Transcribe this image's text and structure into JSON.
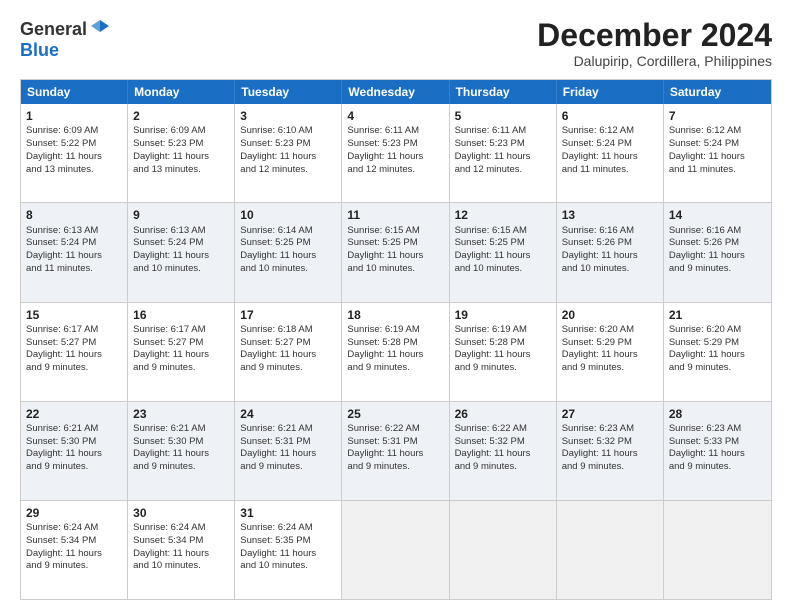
{
  "logo": {
    "general": "General",
    "blue": "Blue"
  },
  "title": {
    "month": "December 2024",
    "location": "Dalupirip, Cordillera, Philippines"
  },
  "header_days": [
    "Sunday",
    "Monday",
    "Tuesday",
    "Wednesday",
    "Thursday",
    "Friday",
    "Saturday"
  ],
  "weeks": [
    [
      {
        "day": "1",
        "lines": [
          "Sunrise: 6:09 AM",
          "Sunset: 5:22 PM",
          "Daylight: 11 hours",
          "and 13 minutes."
        ]
      },
      {
        "day": "2",
        "lines": [
          "Sunrise: 6:09 AM",
          "Sunset: 5:23 PM",
          "Daylight: 11 hours",
          "and 13 minutes."
        ]
      },
      {
        "day": "3",
        "lines": [
          "Sunrise: 6:10 AM",
          "Sunset: 5:23 PM",
          "Daylight: 11 hours",
          "and 12 minutes."
        ]
      },
      {
        "day": "4",
        "lines": [
          "Sunrise: 6:11 AM",
          "Sunset: 5:23 PM",
          "Daylight: 11 hours",
          "and 12 minutes."
        ]
      },
      {
        "day": "5",
        "lines": [
          "Sunrise: 6:11 AM",
          "Sunset: 5:23 PM",
          "Daylight: 11 hours",
          "and 12 minutes."
        ]
      },
      {
        "day": "6",
        "lines": [
          "Sunrise: 6:12 AM",
          "Sunset: 5:24 PM",
          "Daylight: 11 hours",
          "and 11 minutes."
        ]
      },
      {
        "day": "7",
        "lines": [
          "Sunrise: 6:12 AM",
          "Sunset: 5:24 PM",
          "Daylight: 11 hours",
          "and 11 minutes."
        ]
      }
    ],
    [
      {
        "day": "8",
        "lines": [
          "Sunrise: 6:13 AM",
          "Sunset: 5:24 PM",
          "Daylight: 11 hours",
          "and 11 minutes."
        ]
      },
      {
        "day": "9",
        "lines": [
          "Sunrise: 6:13 AM",
          "Sunset: 5:24 PM",
          "Daylight: 11 hours",
          "and 10 minutes."
        ]
      },
      {
        "day": "10",
        "lines": [
          "Sunrise: 6:14 AM",
          "Sunset: 5:25 PM",
          "Daylight: 11 hours",
          "and 10 minutes."
        ]
      },
      {
        "day": "11",
        "lines": [
          "Sunrise: 6:15 AM",
          "Sunset: 5:25 PM",
          "Daylight: 11 hours",
          "and 10 minutes."
        ]
      },
      {
        "day": "12",
        "lines": [
          "Sunrise: 6:15 AM",
          "Sunset: 5:25 PM",
          "Daylight: 11 hours",
          "and 10 minutes."
        ]
      },
      {
        "day": "13",
        "lines": [
          "Sunrise: 6:16 AM",
          "Sunset: 5:26 PM",
          "Daylight: 11 hours",
          "and 10 minutes."
        ]
      },
      {
        "day": "14",
        "lines": [
          "Sunrise: 6:16 AM",
          "Sunset: 5:26 PM",
          "Daylight: 11 hours",
          "and 9 minutes."
        ]
      }
    ],
    [
      {
        "day": "15",
        "lines": [
          "Sunrise: 6:17 AM",
          "Sunset: 5:27 PM",
          "Daylight: 11 hours",
          "and 9 minutes."
        ]
      },
      {
        "day": "16",
        "lines": [
          "Sunrise: 6:17 AM",
          "Sunset: 5:27 PM",
          "Daylight: 11 hours",
          "and 9 minutes."
        ]
      },
      {
        "day": "17",
        "lines": [
          "Sunrise: 6:18 AM",
          "Sunset: 5:27 PM",
          "Daylight: 11 hours",
          "and 9 minutes."
        ]
      },
      {
        "day": "18",
        "lines": [
          "Sunrise: 6:19 AM",
          "Sunset: 5:28 PM",
          "Daylight: 11 hours",
          "and 9 minutes."
        ]
      },
      {
        "day": "19",
        "lines": [
          "Sunrise: 6:19 AM",
          "Sunset: 5:28 PM",
          "Daylight: 11 hours",
          "and 9 minutes."
        ]
      },
      {
        "day": "20",
        "lines": [
          "Sunrise: 6:20 AM",
          "Sunset: 5:29 PM",
          "Daylight: 11 hours",
          "and 9 minutes."
        ]
      },
      {
        "day": "21",
        "lines": [
          "Sunrise: 6:20 AM",
          "Sunset: 5:29 PM",
          "Daylight: 11 hours",
          "and 9 minutes."
        ]
      }
    ],
    [
      {
        "day": "22",
        "lines": [
          "Sunrise: 6:21 AM",
          "Sunset: 5:30 PM",
          "Daylight: 11 hours",
          "and 9 minutes."
        ]
      },
      {
        "day": "23",
        "lines": [
          "Sunrise: 6:21 AM",
          "Sunset: 5:30 PM",
          "Daylight: 11 hours",
          "and 9 minutes."
        ]
      },
      {
        "day": "24",
        "lines": [
          "Sunrise: 6:21 AM",
          "Sunset: 5:31 PM",
          "Daylight: 11 hours",
          "and 9 minutes."
        ]
      },
      {
        "day": "25",
        "lines": [
          "Sunrise: 6:22 AM",
          "Sunset: 5:31 PM",
          "Daylight: 11 hours",
          "and 9 minutes."
        ]
      },
      {
        "day": "26",
        "lines": [
          "Sunrise: 6:22 AM",
          "Sunset: 5:32 PM",
          "Daylight: 11 hours",
          "and 9 minutes."
        ]
      },
      {
        "day": "27",
        "lines": [
          "Sunrise: 6:23 AM",
          "Sunset: 5:32 PM",
          "Daylight: 11 hours",
          "and 9 minutes."
        ]
      },
      {
        "day": "28",
        "lines": [
          "Sunrise: 6:23 AM",
          "Sunset: 5:33 PM",
          "Daylight: 11 hours",
          "and 9 minutes."
        ]
      }
    ],
    [
      {
        "day": "29",
        "lines": [
          "Sunrise: 6:24 AM",
          "Sunset: 5:34 PM",
          "Daylight: 11 hours",
          "and 9 minutes."
        ]
      },
      {
        "day": "30",
        "lines": [
          "Sunrise: 6:24 AM",
          "Sunset: 5:34 PM",
          "Daylight: 11 hours",
          "and 10 minutes."
        ]
      },
      {
        "day": "31",
        "lines": [
          "Sunrise: 6:24 AM",
          "Sunset: 5:35 PM",
          "Daylight: 11 hours",
          "and 10 minutes."
        ]
      },
      {
        "day": "",
        "lines": []
      },
      {
        "day": "",
        "lines": []
      },
      {
        "day": "",
        "lines": []
      },
      {
        "day": "",
        "lines": []
      }
    ]
  ]
}
